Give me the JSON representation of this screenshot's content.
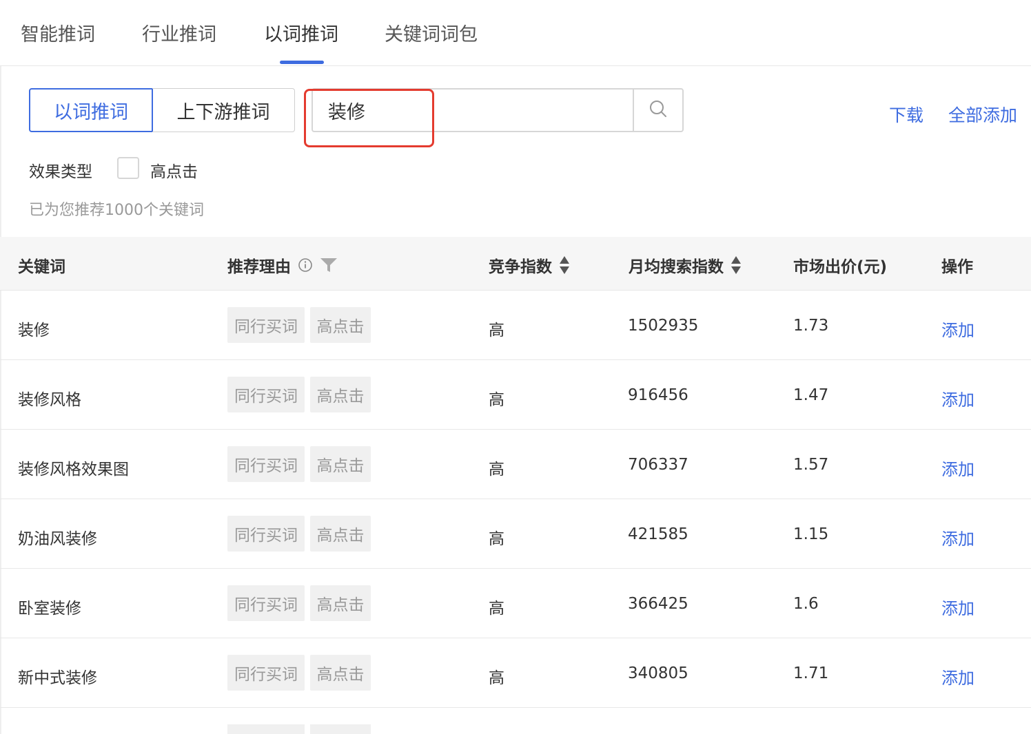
{
  "tabs": [
    {
      "label": "智能推词"
    },
    {
      "label": "行业推词"
    },
    {
      "label": "以词推词"
    },
    {
      "label": "关键词词包"
    }
  ],
  "active_tab": "以词推词",
  "mode": {
    "options": [
      "以词推词",
      "上下游推词"
    ],
    "selected": "以词推词"
  },
  "search": {
    "value": "装修",
    "icon": "search-icon"
  },
  "actions": {
    "download": "下载",
    "add_all": "全部添加"
  },
  "filter": {
    "label": "效果类型",
    "checkbox_label": "高点击",
    "checked": false
  },
  "hint": "已为您推荐1000个关键词",
  "table": {
    "headers": {
      "keyword": "关键词",
      "reason": "推荐理由",
      "competition": "竞争指数",
      "monthly_search": "月均搜索指数",
      "bid": "市场出价(元)",
      "action": "操作"
    },
    "rows": [
      {
        "keyword": "装修",
        "tags": [
          "同行买词",
          "高点击"
        ],
        "competition": "高",
        "monthly_search": "1502935",
        "bid": "1.73",
        "action": "添加"
      },
      {
        "keyword": "装修风格",
        "tags": [
          "同行买词",
          "高点击"
        ],
        "competition": "高",
        "monthly_search": "916456",
        "bid": "1.47",
        "action": "添加"
      },
      {
        "keyword": "装修风格效果图",
        "tags": [
          "同行买词",
          "高点击"
        ],
        "competition": "高",
        "monthly_search": "706337",
        "bid": "1.57",
        "action": "添加"
      },
      {
        "keyword": "奶油风装修",
        "tags": [
          "同行买词",
          "高点击"
        ],
        "competition": "高",
        "monthly_search": "421585",
        "bid": "1.15",
        "action": "添加"
      },
      {
        "keyword": "卧室装修",
        "tags": [
          "同行买词",
          "高点击"
        ],
        "competition": "高",
        "monthly_search": "366425",
        "bid": "1.6",
        "action": "添加"
      },
      {
        "keyword": "新中式装修",
        "tags": [
          "同行买词",
          "高点击"
        ],
        "competition": "高",
        "monthly_search": "340805",
        "bid": "1.71",
        "action": "添加"
      }
    ]
  },
  "colors": {
    "accent": "#3e6ce0",
    "highlight": "#e43b2f"
  }
}
